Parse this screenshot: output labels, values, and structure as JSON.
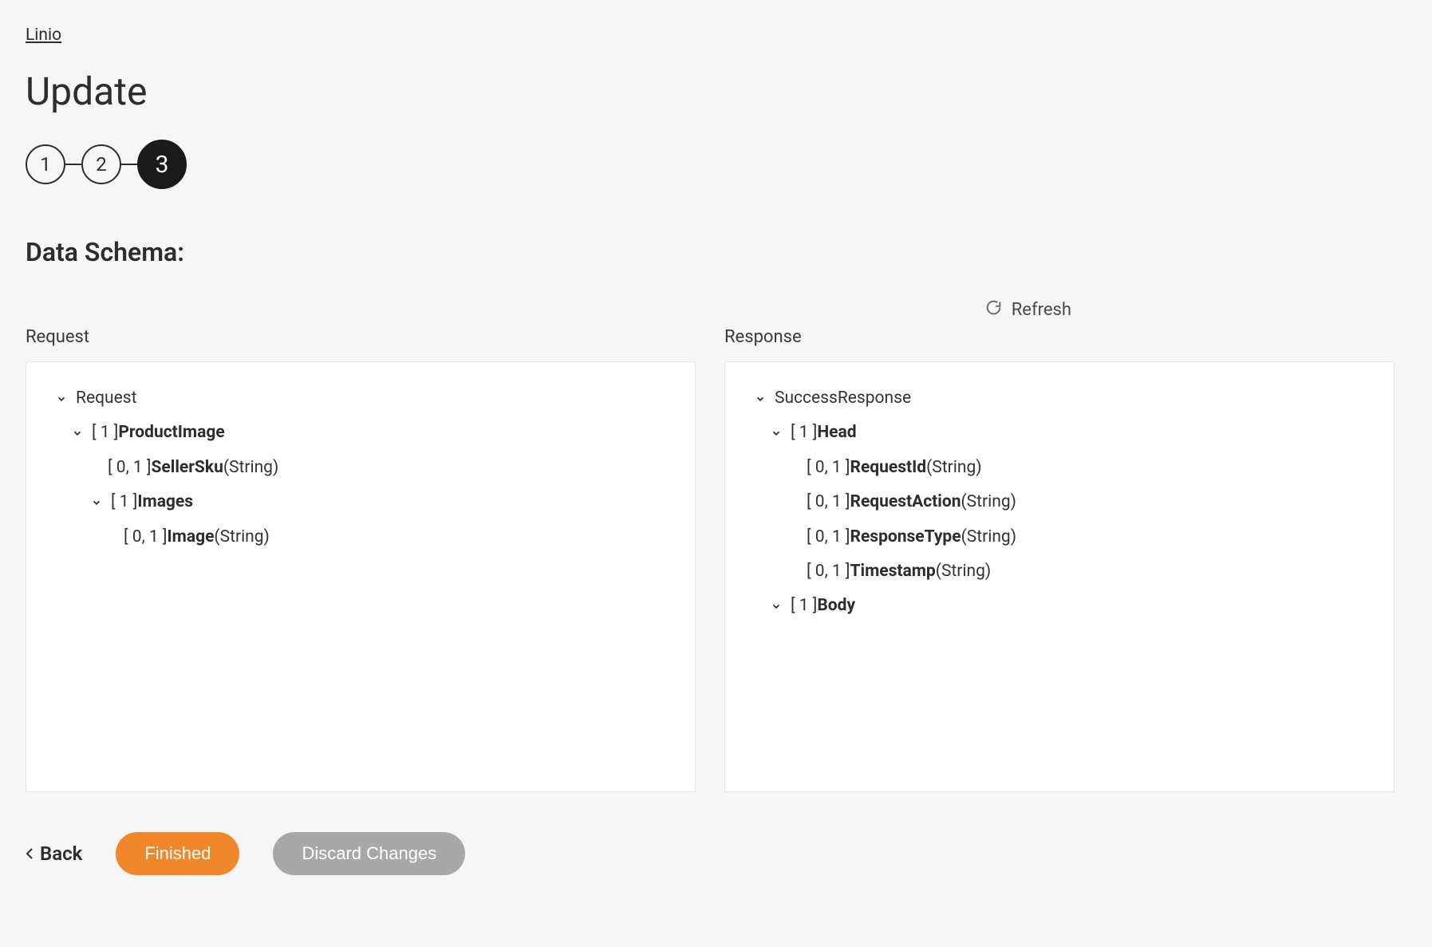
{
  "breadcrumb": "Linio",
  "pageTitle": "Update",
  "stepper": {
    "steps": [
      "1",
      "2",
      "3"
    ],
    "activeIndex": 2
  },
  "sectionTitle": "Data Schema:",
  "refreshLabel": "Refresh",
  "columns": {
    "request": {
      "label": "Request",
      "tree": [
        {
          "indent": 0,
          "caret": true,
          "cardinality": "",
          "name": "Request",
          "type": "",
          "bold": false
        },
        {
          "indent": 1,
          "caret": true,
          "cardinality": "[ 1 ]",
          "name": "ProductImage",
          "type": "",
          "bold": true
        },
        {
          "indent": 2,
          "caret": false,
          "cardinality": "[ 0, 1 ]",
          "name": "SellerSku",
          "type": "(String)",
          "bold": true
        },
        {
          "indent": 2,
          "caret": true,
          "cardinality": "[ 1 ]",
          "name": "Images",
          "type": "",
          "bold": true
        },
        {
          "indent": 3,
          "caret": false,
          "cardinality": "[ 0, 1 ]",
          "name": "Image",
          "type": "(String)",
          "bold": true
        }
      ]
    },
    "response": {
      "label": "Response",
      "tree": [
        {
          "indent": 0,
          "caret": true,
          "cardinality": "",
          "name": "SuccessResponse",
          "type": "",
          "bold": false
        },
        {
          "indent": 1,
          "caret": true,
          "cardinality": "[ 1 ]",
          "name": "Head",
          "type": "",
          "bold": true
        },
        {
          "indent": 2,
          "caret": false,
          "cardinality": "[ 0, 1 ]",
          "name": "RequestId",
          "type": "(String)",
          "bold": true
        },
        {
          "indent": 2,
          "caret": false,
          "cardinality": "[ 0, 1 ]",
          "name": "RequestAction",
          "type": "(String)",
          "bold": true
        },
        {
          "indent": 2,
          "caret": false,
          "cardinality": "[ 0, 1 ]",
          "name": "ResponseType",
          "type": "(String)",
          "bold": true
        },
        {
          "indent": 2,
          "caret": false,
          "cardinality": "[ 0, 1 ]",
          "name": "Timestamp",
          "type": "(String)",
          "bold": true
        },
        {
          "indent": 1,
          "caret": true,
          "cardinality": "[ 1 ]",
          "name": "Body",
          "type": "",
          "bold": true
        }
      ]
    }
  },
  "footer": {
    "back": "Back",
    "finished": "Finished",
    "discard": "Discard Changes"
  }
}
